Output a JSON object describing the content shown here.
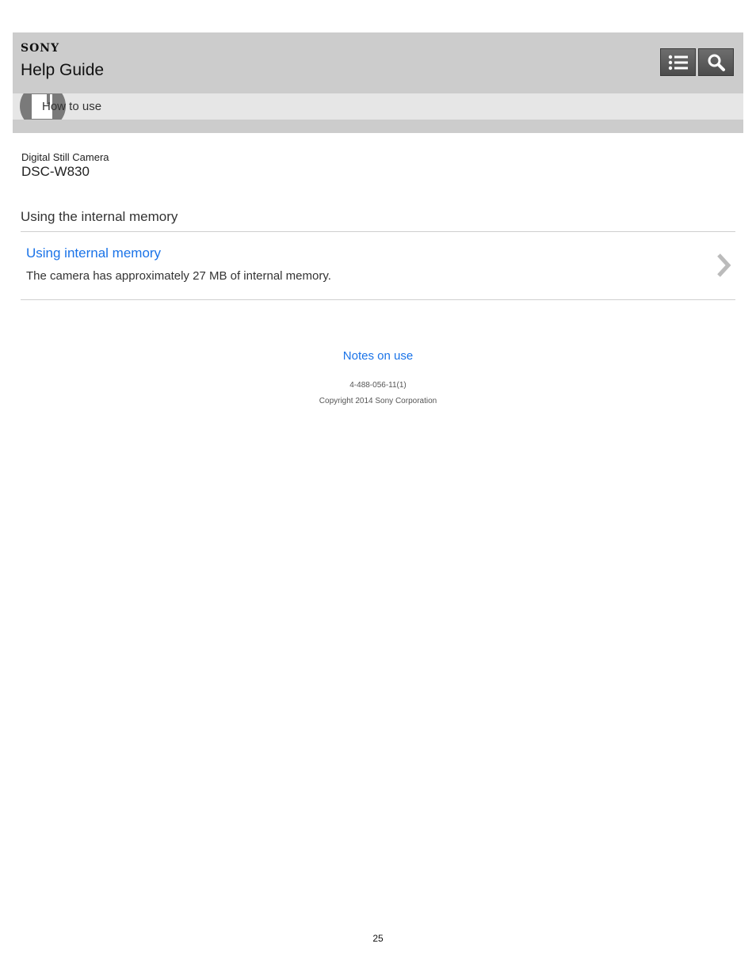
{
  "header": {
    "brand": "SONY",
    "title": "Help Guide",
    "menu_icon": "list-menu-icon",
    "search_icon": "search-icon"
  },
  "category": {
    "label": "How to use",
    "icon": "book-icon"
  },
  "product": {
    "category": "Digital Still Camera",
    "model": "DSC-W830"
  },
  "page": {
    "title": "Using the internal memory"
  },
  "topics": [
    {
      "title": "Using internal memory",
      "description": "The camera has approximately 27 MB of internal memory.",
      "icon": "chevron-right-icon"
    }
  ],
  "footer": {
    "notes_link": "Notes on use",
    "doc_number": "4-488-056-11(1)",
    "copyright": "Copyright 2014 Sony Corporation",
    "page_number": "25"
  },
  "colors": {
    "header_bg": "#cccccc",
    "category_bg": "#e6e6e6",
    "link": "#1a73e8",
    "button_bg": "#5a5a5a"
  }
}
